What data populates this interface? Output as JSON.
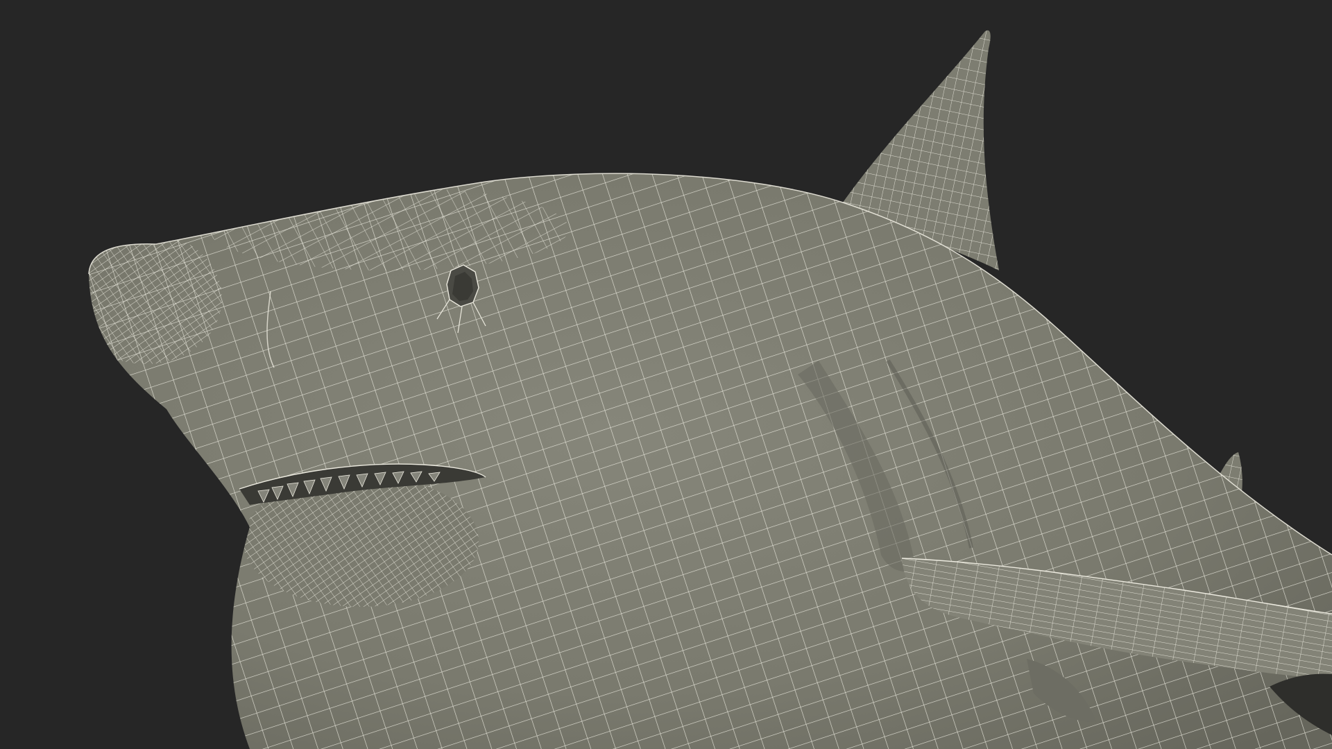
{
  "viewport": {
    "subject": "shark-wireframe-render",
    "colors": {
      "background": "#262626",
      "surface": "#7c7c70",
      "surface_shadow": "#5f5f55",
      "surface_highlight": "#8b8b7f",
      "wire": "#eceadf",
      "dark_interior": "#3a3a35"
    }
  }
}
